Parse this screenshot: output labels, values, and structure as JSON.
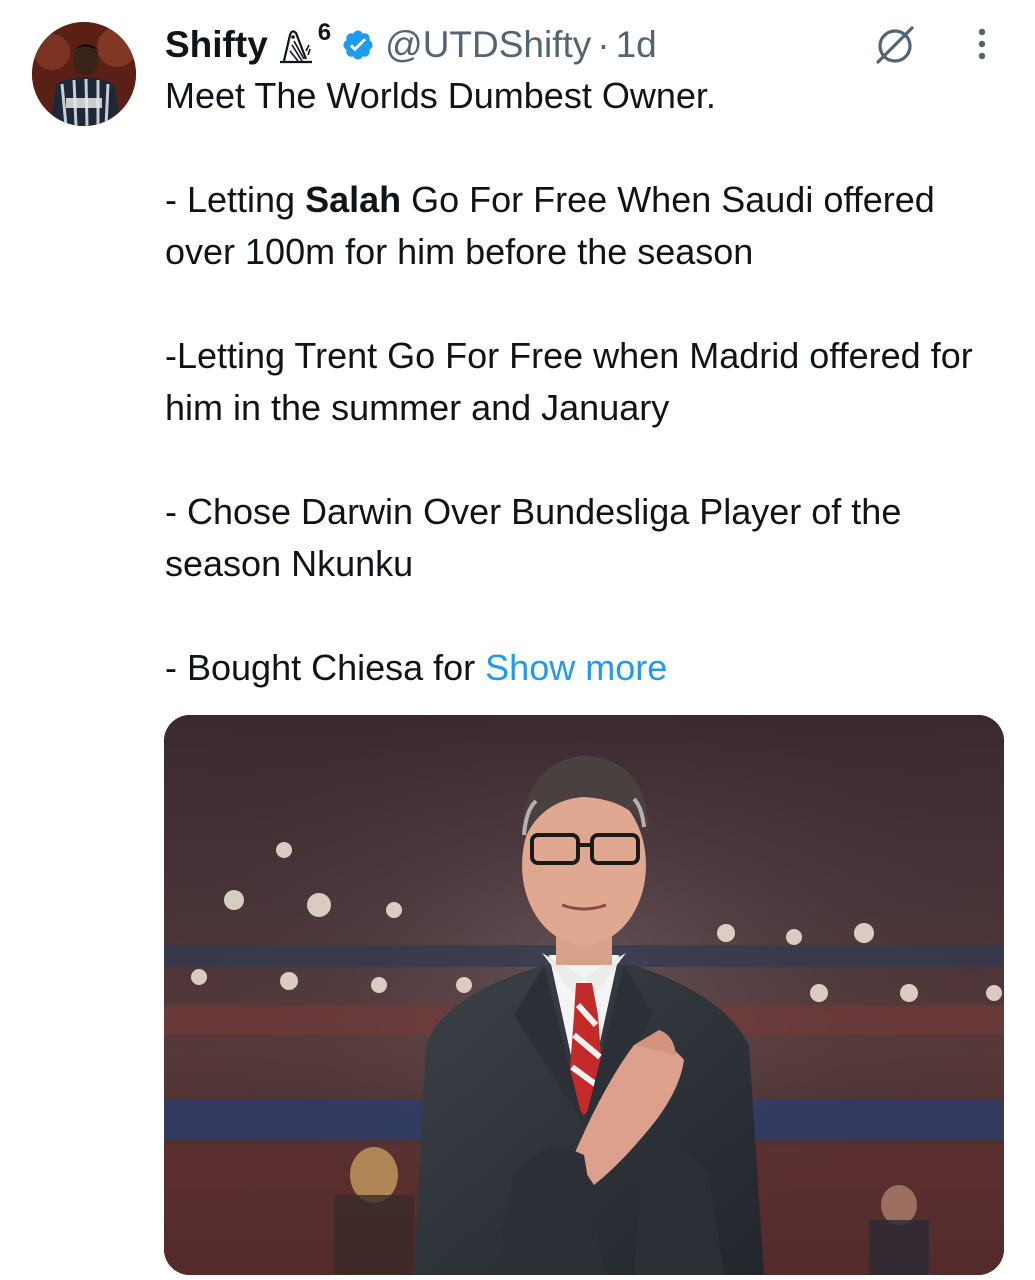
{
  "author": {
    "display_name": "Shifty",
    "badge_count": "6",
    "handle": "@UTDShifty",
    "separator": "·",
    "time": "1d"
  },
  "icons": {
    "badge": "owl-icon",
    "verified": "verified-badge-icon",
    "grok": "grok-icon",
    "more": "more-vertical-icon"
  },
  "tweet": {
    "line1": "Meet The Worlds Dumbest Owner.",
    "p2_prefix": "- Letting ",
    "p2_bold": "Salah",
    "p2_suffix": " Go For Free When Saudi offered over 100m for him before the season",
    "p3": "-Letting Trent Go For Free when Madrid offered for him in the summer and January",
    "p4": "- Chose Darwin Over Bundesliga Player of the season Nkunku",
    "p5": "- Bought Chiesa for ",
    "show_more": "Show more"
  },
  "colors": {
    "text": "#0f1419",
    "secondary": "#536471",
    "link": "#1d9bf0",
    "verified": "#1d9bf0"
  }
}
